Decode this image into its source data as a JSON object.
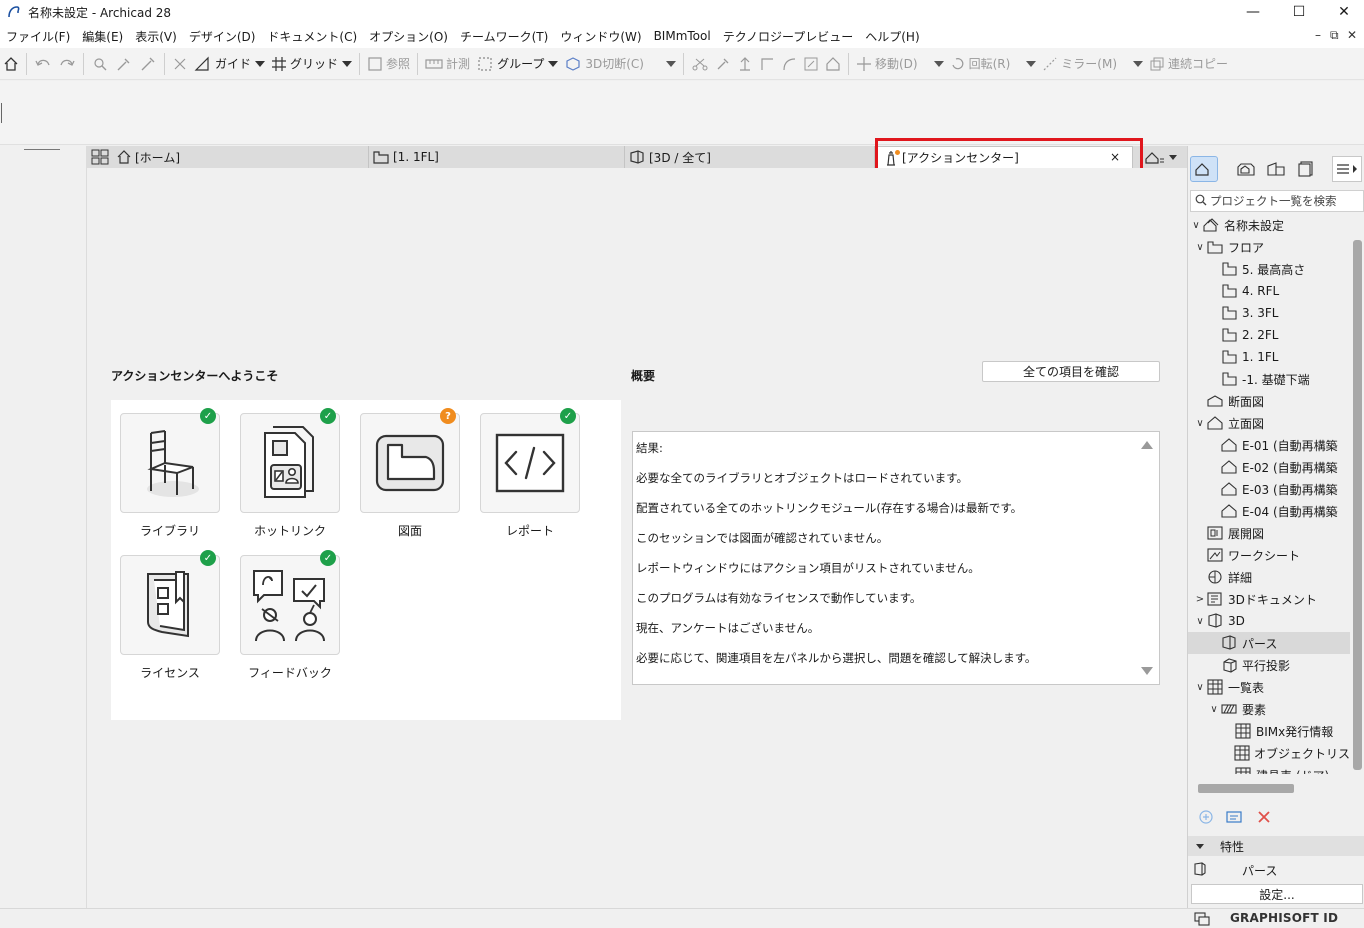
{
  "window": {
    "title": "名称未設定 - Archicad 28",
    "minimize": "—",
    "maximize": "☐",
    "close": "✕"
  },
  "menubar": {
    "items": [
      "ファイル(F)",
      "編集(E)",
      "表示(V)",
      "デザイン(D)",
      "ドキュメント(C)",
      "オプション(O)",
      "チームワーク(T)",
      "ウィンドウ(W)",
      "BIMmTool",
      "テクノロジープレビュー",
      "ヘルプ(H)"
    ],
    "doc_minimize": "–",
    "doc_restore": "⧉",
    "doc_close": "✕"
  },
  "toolbar": {
    "guide": "ガイド",
    "grid": "グリッド",
    "reference": "参照",
    "measure": "計測",
    "group": "グループ",
    "cut3d": "3D切断(C)",
    "move": "移動(D)",
    "rotate": "回転(R)",
    "mirror": "ミラー(M)",
    "multi_copy": "連続コピー"
  },
  "tabs": [
    {
      "label": "[ホーム]",
      "icon": "home-icon"
    },
    {
      "label": "[1. 1FL]",
      "icon": "floor-plan-icon"
    },
    {
      "label": "[3D / 全て]",
      "icon": "3d-icon"
    },
    {
      "label": "[アクションセンター]",
      "icon": "action-center-icon",
      "close": "×"
    }
  ],
  "action_center": {
    "welcome_title": "アクションセンターへようこそ",
    "overview_title": "概要",
    "confirm_all_button": "全ての項目を確認",
    "tiles": [
      {
        "label": "ライブラリ",
        "icon": "chair-library-icon",
        "status": "ok"
      },
      {
        "label": "ホットリンク",
        "icon": "hotlink-icon",
        "status": "ok"
      },
      {
        "label": "図面",
        "icon": "drawing-icon",
        "status": "warn"
      },
      {
        "label": "レポート",
        "icon": "report-code-icon",
        "status": "ok"
      },
      {
        "label": "ライセンス",
        "icon": "license-icon",
        "status": "ok"
      },
      {
        "label": "フィードバック",
        "icon": "feedback-icon",
        "status": "ok"
      }
    ],
    "badge_ok": "✓",
    "badge_warn": "?",
    "results": [
      "結果:",
      "必要な全てのライブラリとオブジェクトはロードされています。",
      "配置されている全てのホットリンクモジュール(存在する場合)は最新です。",
      "このセッションでは図面が確認されていません。",
      "レポートウィンドウにはアクション項目がリストされていません。",
      "このプログラムは有効なライセンスで動作しています。",
      "現在、アンケートはございません。",
      "必要に応じて、関連項目を左パネルから選択し、問題を確認して解決します。"
    ]
  },
  "navigator": {
    "search_placeholder": "プロジェクト一覧を検索",
    "tree": [
      {
        "label": "名称未設定",
        "level": 0,
        "chev": "∨",
        "icon": "project-icon"
      },
      {
        "label": "フロア",
        "level": 1,
        "chev": "∨",
        "icon": "story-folder-icon"
      },
      {
        "label": "5. 最高高さ",
        "level": 2,
        "chev": "",
        "icon": "story-icon"
      },
      {
        "label": "4. RFL",
        "level": 2,
        "chev": "",
        "icon": "story-icon"
      },
      {
        "label": "3. 3FL",
        "level": 2,
        "chev": "",
        "icon": "story-icon"
      },
      {
        "label": "2. 2FL",
        "level": 2,
        "chev": "",
        "icon": "story-icon"
      },
      {
        "label": "1. 1FL",
        "level": 2,
        "chev": "",
        "icon": "story-icon"
      },
      {
        "label": "-1. 基礎下端",
        "level": 2,
        "chev": "",
        "icon": "story-icon"
      },
      {
        "label": "断面図",
        "level": 1,
        "chev": "",
        "icon": "section-icon"
      },
      {
        "label": "立面図",
        "level": 1,
        "chev": "∨",
        "icon": "elevation-icon"
      },
      {
        "label": "E-01 (自動再構築",
        "level": 2,
        "chev": "",
        "icon": "elevation-icon"
      },
      {
        "label": "E-02 (自動再構築",
        "level": 2,
        "chev": "",
        "icon": "elevation-icon"
      },
      {
        "label": "E-03 (自動再構築",
        "level": 2,
        "chev": "",
        "icon": "elevation-icon"
      },
      {
        "label": "E-04 (自動再構築",
        "level": 2,
        "chev": "",
        "icon": "elevation-icon"
      },
      {
        "label": "展開図",
        "level": 1,
        "chev": "",
        "icon": "interior-elevation-icon"
      },
      {
        "label": "ワークシート",
        "level": 1,
        "chev": "",
        "icon": "worksheet-icon"
      },
      {
        "label": "詳細",
        "level": 1,
        "chev": "",
        "icon": "detail-icon"
      },
      {
        "label": "3Dドキュメント",
        "level": 1,
        "chev": ">",
        "icon": "3d-document-icon"
      },
      {
        "label": "3D",
        "level": 1,
        "chev": "∨",
        "icon": "3d-icon"
      },
      {
        "label": "パース",
        "level": 2,
        "chev": "",
        "icon": "perspective-icon",
        "selected": true
      },
      {
        "label": "平行投影",
        "level": 2,
        "chev": "",
        "icon": "axonometry-icon"
      },
      {
        "label": "一覧表",
        "level": 1,
        "chev": "∨",
        "icon": "schedule-icon"
      },
      {
        "label": "要素",
        "level": 2,
        "chev": "∨",
        "icon": "element-schedule-icon"
      },
      {
        "label": "BIMx発行情報",
        "level": 3,
        "chev": "",
        "icon": "table-icon"
      },
      {
        "label": "オブジェクトリスト",
        "level": 3,
        "chev": "",
        "icon": "table-icon"
      },
      {
        "label": "建具表 (ドア)",
        "level": 3,
        "chev": "",
        "icon": "table-icon"
      }
    ],
    "properties_label": "特性",
    "properties_value": "パース",
    "settings_button": "設定..."
  },
  "statusbar": {
    "graphisoft_id": "GRAPHISOFT ID"
  },
  "colors": {
    "highlight": "#e0161d",
    "ok_badge": "#1ea04a",
    "warn_badge": "#f08c1e"
  }
}
